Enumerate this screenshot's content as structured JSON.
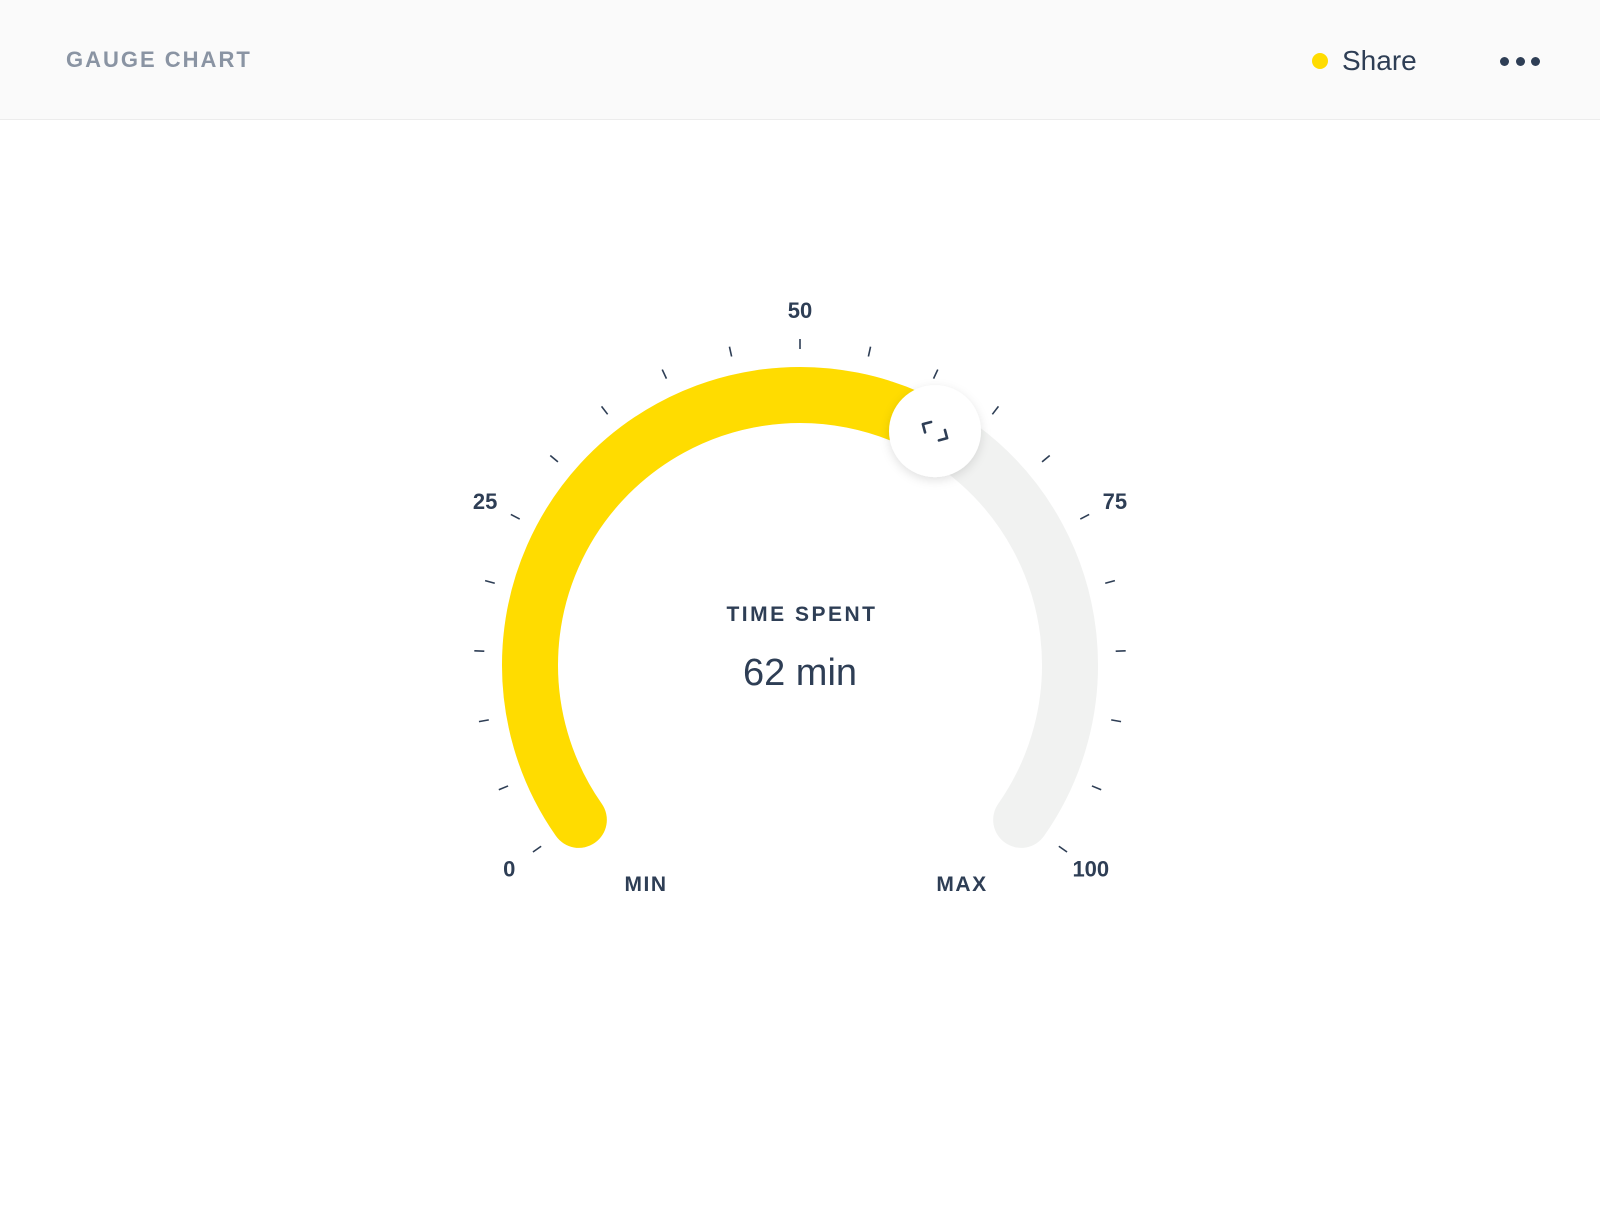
{
  "header": {
    "title": "GAUGE CHART",
    "share_label": "Share",
    "share_dot_color": "#ffdc00",
    "more_icon": "more-horizontal-icon"
  },
  "gauge": {
    "label": "TIME SPENT",
    "value_text": "62 min",
    "min_label": "MIN",
    "max_label": "MAX",
    "handle_icon": "chevrons-left-right-icon"
  },
  "chart_data": {
    "type": "gauge",
    "value": 62,
    "min": 0,
    "max": 100,
    "major_ticks": [
      0,
      25,
      50,
      75,
      100
    ],
    "tick_labels": [
      "0",
      "25",
      "50",
      "75",
      "100"
    ],
    "minor_tick_step": 5,
    "fill_color": "#ffdc00",
    "track_color": "#f1f2f1",
    "tick_color": "#2e3e55"
  }
}
